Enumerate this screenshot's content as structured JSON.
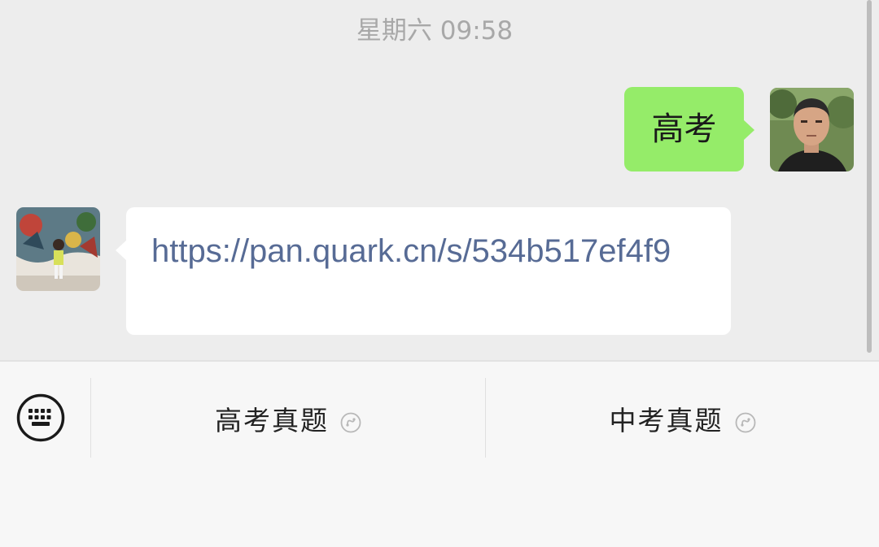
{
  "chat": {
    "timestamp": "星期六 09:58",
    "messages": [
      {
        "direction": "outgoing",
        "text": "高考"
      },
      {
        "direction": "incoming",
        "text": "https://pan.quark.cn/s/534b517ef4f9"
      }
    ]
  },
  "menu": {
    "items": [
      {
        "label": "高考真题",
        "icon": "mini-program-icon"
      },
      {
        "label": "中考真题",
        "icon": "mini-program-icon"
      }
    ],
    "keyboard_icon": "keyboard-icon"
  },
  "colors": {
    "chat_background": "#ededed",
    "outgoing_bubble": "#95ec69",
    "incoming_bubble": "#ffffff",
    "link": "#576b95",
    "menu_background": "#f7f7f7"
  }
}
